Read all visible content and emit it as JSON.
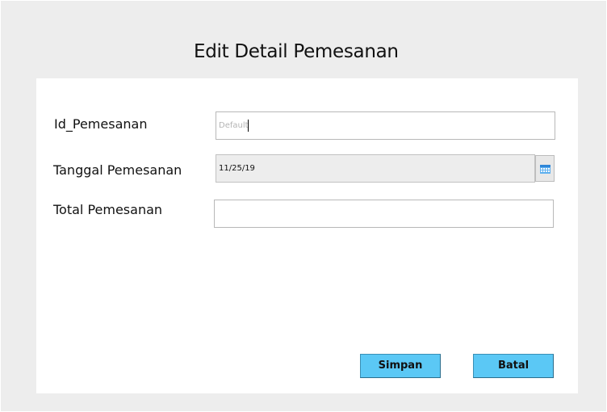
{
  "form": {
    "title": "Edit Detail Pemesanan",
    "fields": {
      "id_pemesanan": {
        "label": "Id_Pemesanan",
        "value": "",
        "placeholder": "Default"
      },
      "tanggal_pemesanan": {
        "label": "Tanggal Pemesanan",
        "value": "11/25/19",
        "picker_icon": "calendar-icon"
      },
      "total_pemesanan": {
        "label": "Total Pemesanan",
        "value": ""
      }
    },
    "buttons": {
      "save_label": "Simpan",
      "cancel_label": "Batal"
    }
  },
  "colors": {
    "window_background": "#ededed",
    "panel_background": "#ffffff",
    "button_background": "#5bc8f5",
    "calendar_icon": "#2e86d8"
  }
}
